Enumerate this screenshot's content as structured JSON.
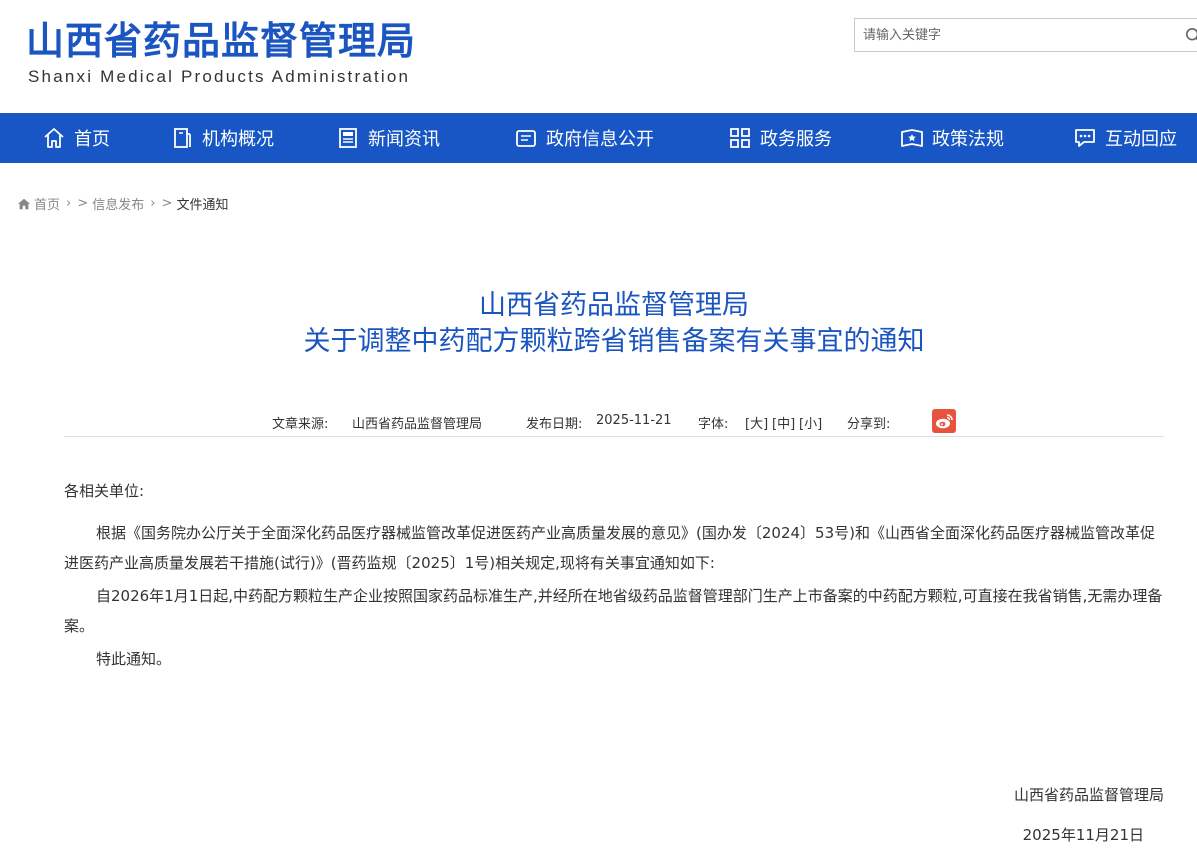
{
  "header": {
    "logo_cn": "山西省药品监督管理局",
    "logo_en": "Shanxi Medical Products Administration",
    "search_placeholder": "请输入关键字"
  },
  "nav": {
    "items": [
      {
        "label": "首页",
        "icon": "home-icon"
      },
      {
        "label": "机构概况",
        "icon": "building-icon"
      },
      {
        "label": "新闻资讯",
        "icon": "newspaper-icon"
      },
      {
        "label": "政府信息公开",
        "icon": "document-icon"
      },
      {
        "label": "政务服务",
        "icon": "grid-icon"
      },
      {
        "label": "政策法规",
        "icon": "book-icon"
      },
      {
        "label": "互动回应",
        "icon": "chat-icon"
      }
    ]
  },
  "breadcrumb": {
    "home": "首页",
    "level1": "信息发布",
    "current": "文件通知"
  },
  "article": {
    "title_line1": "山西省药品监督管理局",
    "title_line2": "关于调整中药配方颗粒跨省销售备案有关事宜的通知",
    "source_label": "文章来源:",
    "source_value": "山西省药品监督管理局",
    "date_label": "发布日期:",
    "date_value": "2025-11-21",
    "font_label": "字体:",
    "font_large": "[大]",
    "font_medium": "[中]",
    "font_small": "[小]",
    "share_label": "分享到:",
    "salutation": "各相关单位:",
    "paragraphs": [
      "根据《国务院办公厅关于全面深化药品医疗器械监管改革促进医药产业高质量发展的意见》(国办发〔2024〕53号)和《山西省全面深化药品医疗器械监管改革促进医药产业高质量发展若干措施(试行)》(晋药监规〔2025〕1号)相关规定,现将有关事宜通知如下:",
      "自2026年1月1日起,中药配方颗粒生产企业按照国家药品标准生产,并经所在地省级药品监督管理部门生产上市备案的中药配方颗粒,可直接在我省销售,无需办理备案。",
      "特此通知。"
    ],
    "signature": "山西省药品监督管理局",
    "sign_date": "2025年11月21日"
  },
  "colors": {
    "brand_blue": "#1b55c0",
    "nav_blue": "#1756c4",
    "weibo_red": "#e8533e"
  }
}
